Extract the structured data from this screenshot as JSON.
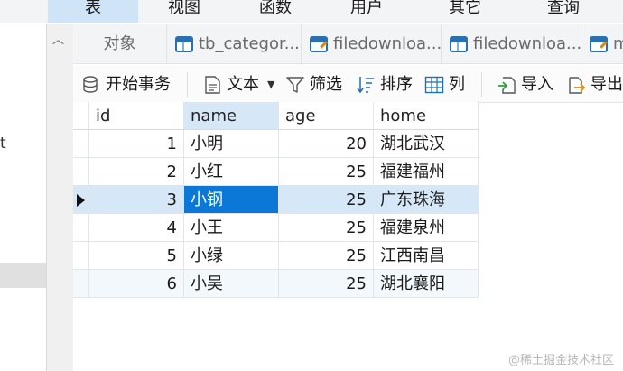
{
  "menu": {
    "items": [
      {
        "label": "表",
        "active": true
      },
      {
        "label": "视图",
        "active": false
      },
      {
        "label": "函数",
        "active": false
      },
      {
        "label": "用户",
        "active": false
      },
      {
        "label": "其它",
        "active": false
      },
      {
        "label": "查询",
        "active": false
      }
    ]
  },
  "sidebar": {
    "partial_text": "t"
  },
  "tabs": {
    "objects_label": "对象",
    "items": [
      {
        "label": "tb_categor...",
        "icon": "table-icon"
      },
      {
        "label": "filedownloa...",
        "icon": "table-edit-icon"
      },
      {
        "label": "filedownloa...",
        "icon": "table-icon"
      },
      {
        "label": "m",
        "icon": "table-edit-icon"
      }
    ]
  },
  "toolbar": {
    "begin_transaction": "开始事务",
    "text": "文本",
    "filter": "筛选",
    "sort": "排序",
    "columns": "列",
    "import": "导入",
    "export": "导出"
  },
  "table": {
    "columns": [
      "id",
      "name",
      "age",
      "home"
    ],
    "rows": [
      {
        "id": "1",
        "name": "小明",
        "age": "20",
        "home": "湖北武汉"
      },
      {
        "id": "2",
        "name": "小红",
        "age": "25",
        "home": "福建福州"
      },
      {
        "id": "3",
        "name": "小钢",
        "age": "25",
        "home": "广东珠海"
      },
      {
        "id": "4",
        "name": "小王",
        "age": "25",
        "home": "福建泉州"
      },
      {
        "id": "5",
        "name": "小绿",
        "age": "25",
        "home": "江西南昌"
      },
      {
        "id": "6",
        "name": "小吴",
        "age": "25",
        "home": "湖北襄阳"
      }
    ],
    "selected_row": 2,
    "selected_column": "name"
  },
  "watermark": "@稀土掘金技术社区",
  "colors": {
    "accent": "#0b78d7",
    "selection_light": "#d6e8f8",
    "menu_active": "#cfe4f7",
    "icon_blue": "#2a6fb0"
  }
}
